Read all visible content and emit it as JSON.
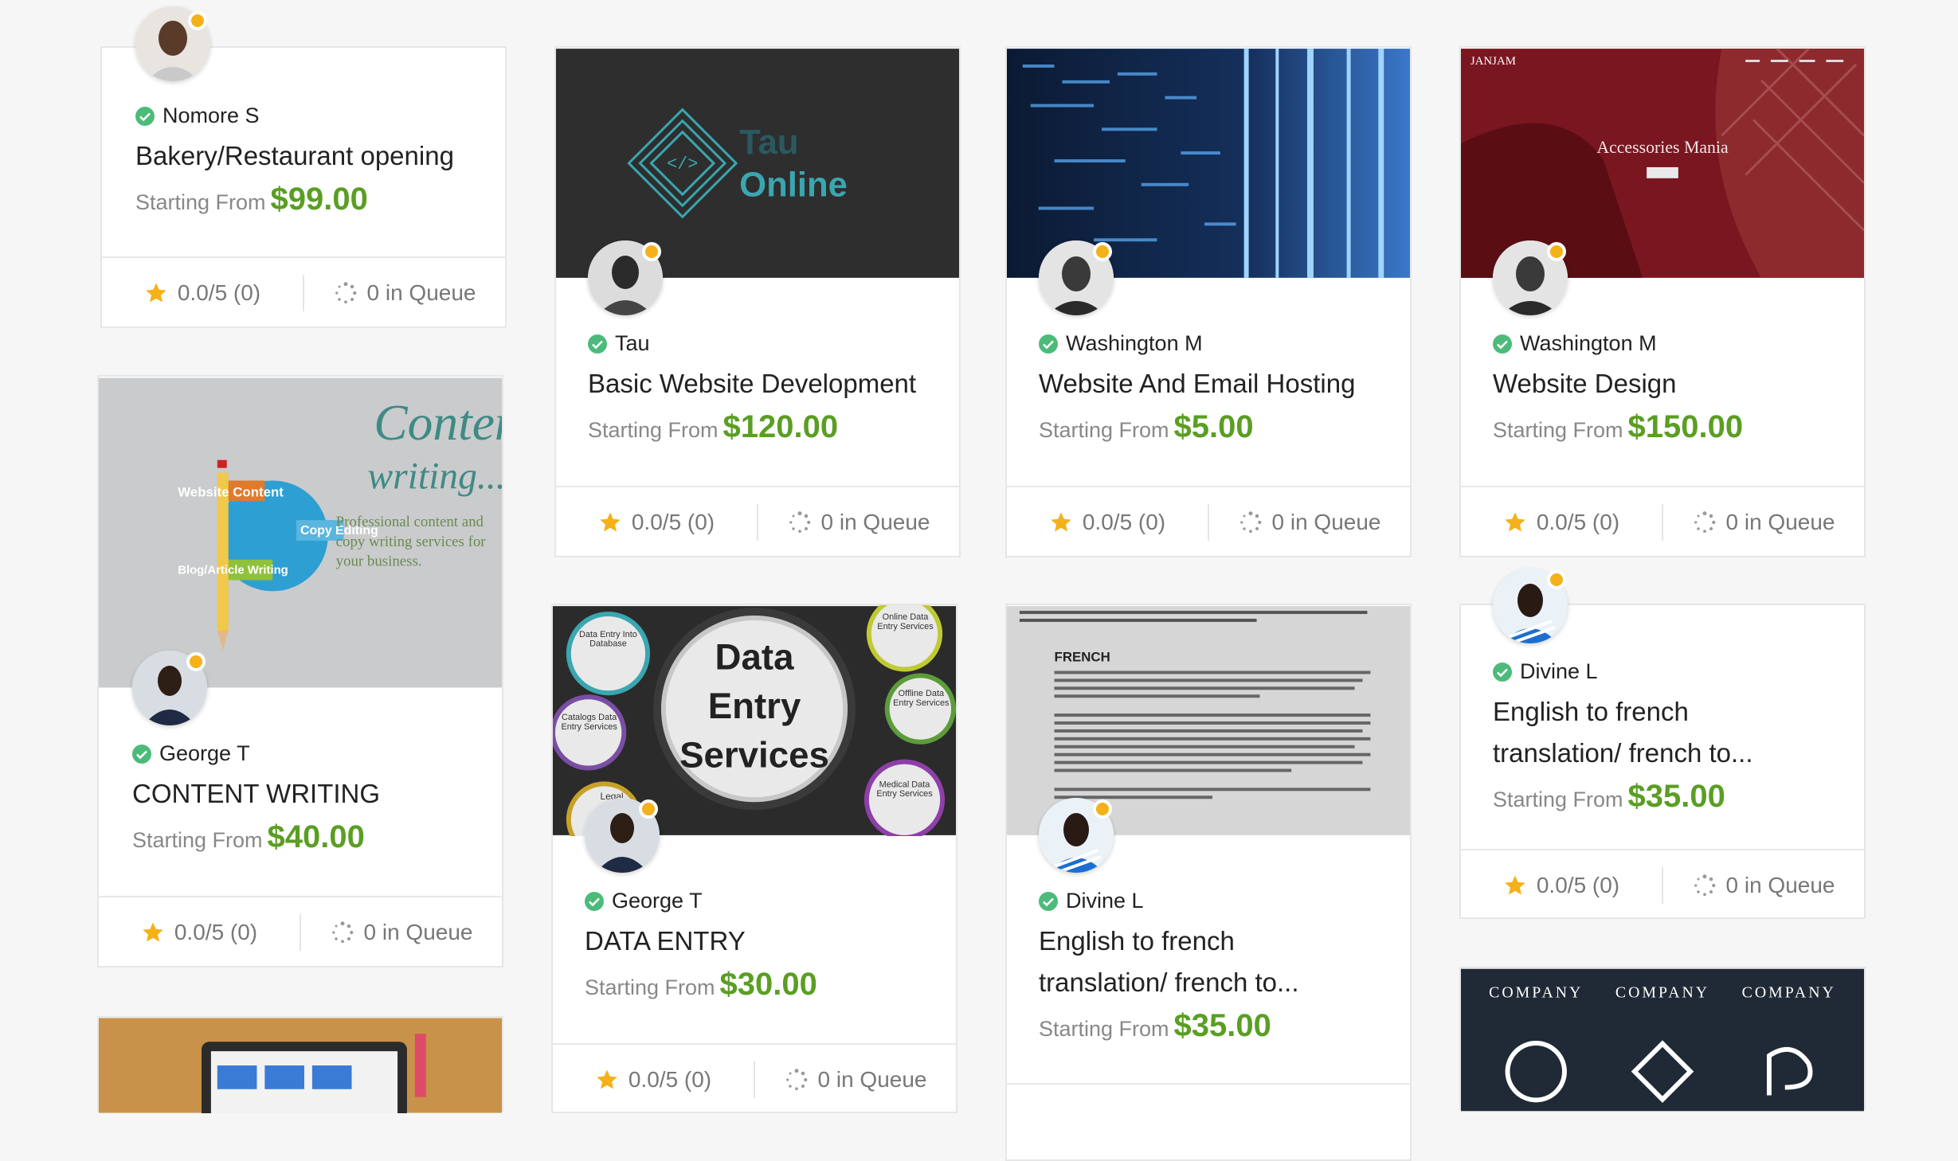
{
  "labels": {
    "starting_from": "Starting From"
  },
  "cards": [
    {
      "seller": "Nomore S",
      "title": "Bakery/Restaurant opening",
      "price": "$99.00",
      "rating": "0.0/5 (0)",
      "queue": "0 in Queue"
    },
    {
      "seller": "Tau",
      "title": "Basic Website Development",
      "price": "$120.00",
      "rating": "0.0/5 (0)",
      "queue": "0 in Queue",
      "image_text": [
        "Tau",
        "Online"
      ]
    },
    {
      "seller": "Washington M",
      "title": "Website And Email Hosting",
      "price": "$5.00",
      "rating": "0.0/5 (0)",
      "queue": "0 in Queue"
    },
    {
      "seller": "Washington M",
      "title": "Website Design",
      "price": "$150.00",
      "rating": "0.0/5 (0)",
      "queue": "0 in Queue",
      "image_text": [
        "JANJAM",
        "Accessories Mania"
      ]
    },
    {
      "seller": "George T",
      "title": "CONTENT WRITING",
      "price": "$40.00",
      "rating": "0.0/5 (0)",
      "queue": "0 in Queue",
      "image_text": [
        "Content",
        "writing....",
        "Website Content",
        "Copy Editing",
        "Blog/Article Writing",
        "Professional content and copy writing services for your business."
      ]
    },
    {
      "seller": "George T",
      "title": "DATA ENTRY",
      "price": "$30.00",
      "rating": "0.0/5 (0)",
      "queue": "0 in Queue",
      "image_text": [
        "Data",
        "Entry",
        "Services",
        "Data Entry Into Database",
        "Online Data Entry Services",
        "Offline Data Entry Services",
        "Catalogs Data Entry Services",
        "Medical Data Entry Services",
        "Legal"
      ]
    },
    {
      "seller": "Divine L",
      "title": "English to french translation/ french to...",
      "price": "$35.00",
      "rating": "0.0/5 (0)",
      "queue": "0 in Queue",
      "image_text": [
        "FRENCH"
      ]
    },
    {
      "seller": "Divine L",
      "title": "English to french translation/ french to...",
      "price": "$35.00",
      "rating": "0.0/5 (0)",
      "queue": "0 in Queue"
    },
    {
      "image_text": [
        "COMPANY",
        "COMPANY",
        "COMPANY"
      ]
    }
  ],
  "colors": {
    "price": "#5a9e23",
    "online": "#f5b11a",
    "verified": "#4cbb7a",
    "star": "#f5b11a"
  }
}
